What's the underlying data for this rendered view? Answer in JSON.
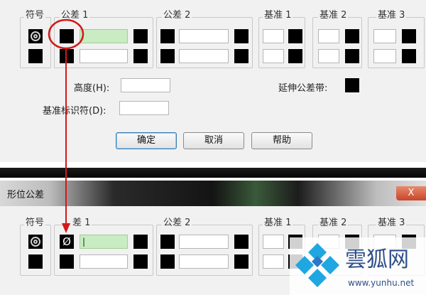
{
  "top_dialog": {
    "labels": {
      "symbol": "符号",
      "tolerance1": "公差 1",
      "tolerance2": "公差 2",
      "datum1": "基准 1",
      "datum2": "基准 2",
      "datum3": "基准 3",
      "height": "高度(H):",
      "datum_identifier": "基准标识符(D):",
      "projected_tolerance_zone": "延伸公差带:"
    },
    "buttons": {
      "ok": "确定",
      "cancel": "取消",
      "help": "帮助"
    }
  },
  "bottom_dialog": {
    "title": "形位公差",
    "close_label": "X",
    "labels": {
      "symbol": "符号",
      "tolerance1": "差 1",
      "tolerance2": "公差 2",
      "datum1": "基准 1",
      "datum2": "基准 2",
      "datum3": "基准 3"
    },
    "diameter_symbol": "Ø",
    "tolerance1_value": "|"
  },
  "watermark": {
    "brand": "雲狐网",
    "url": "www.yunhu.net"
  },
  "colors": {
    "annotation": "#d11a1a",
    "field_active": "#c9ecc3",
    "brand": "#2f4f8a"
  },
  "icons": [
    "position-symbol-icon",
    "diameter-toggle-icon",
    "close-icon",
    "yunhu-logo-icon"
  ]
}
